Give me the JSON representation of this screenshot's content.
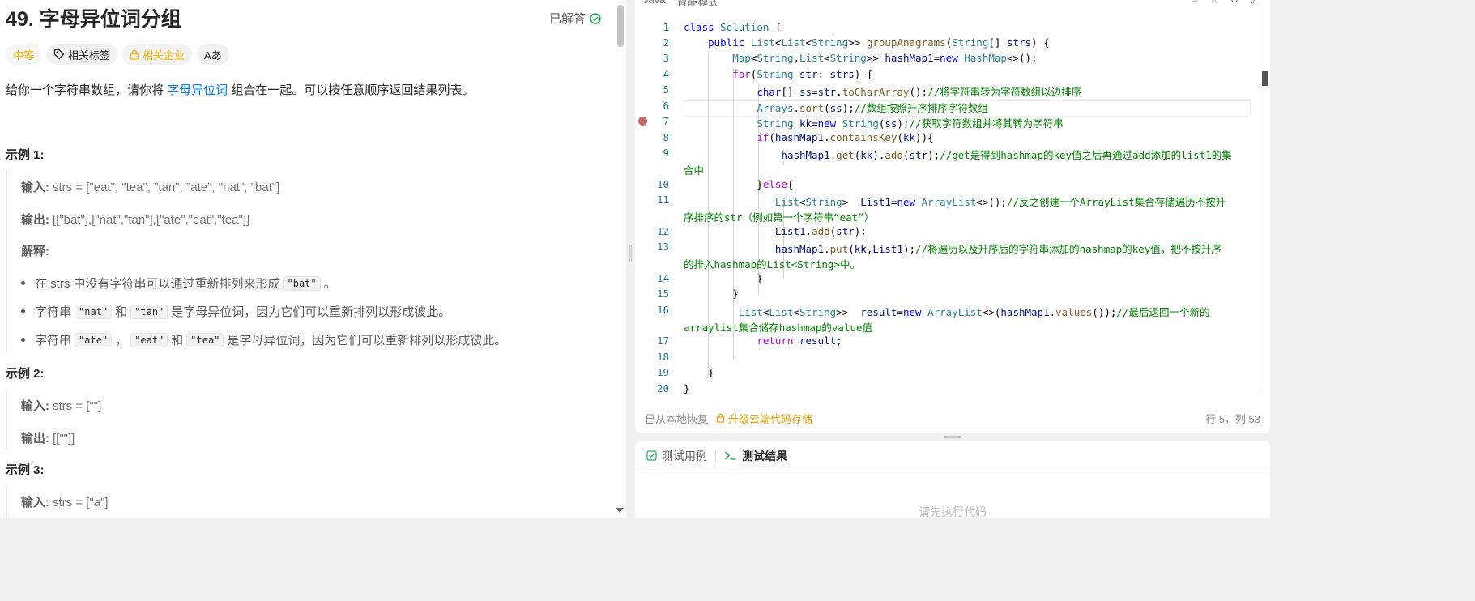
{
  "problem": {
    "title": "49. 字母异位词分组",
    "status": "已解答",
    "tags": [
      "中等",
      "相关标签",
      "相关企业",
      "Aあ"
    ],
    "desc_pre": "给你一个字符串数组，请你将 ",
    "desc_link": "字母异位词",
    "desc_post": " 组合在一起。可以按任意顺序返回结果列表。",
    "ex1_title": "示例 1:",
    "ex1_input_label": "输入:",
    "ex1_input": "strs = [\"eat\", \"tea\", \"tan\", \"ate\", \"nat\", \"bat\"]",
    "ex1_output_label": "输出:",
    "ex1_output": "[[\"bat\"],[\"nat\",\"tan\"],[\"ate\",\"eat\",\"tea\"]]",
    "ex1_expl": "解释:",
    "b1_pre": "在 strs 中没有字符串可以通过重新排列来形成 ",
    "b1_code": "\"bat\"",
    "b1_post": "。",
    "b2_pre": "字符串 ",
    "b2_code1": "\"nat\"",
    "b2_mid": " 和 ",
    "b2_code2": "\"tan\"",
    "b2_post": " 是字母异位词，因为它们可以重新排列以形成彼此。",
    "b3_pre": "字符串 ",
    "b3_code1": "\"ate\"",
    "b3_sep1": " ，",
    "b3_code2": "\"eat\"",
    "b3_sep2": " 和 ",
    "b3_code3": "\"tea\"",
    "b3_post": " 是字母异位词，因为它们可以重新排列以形成彼此。",
    "ex2_title": "示例 2:",
    "ex2_input_label": "输入:",
    "ex2_input": "strs = [\"\"]",
    "ex2_output_label": "输出:",
    "ex2_output": "[[\"\"]]",
    "ex3_title": "示例 3:",
    "ex3_input_label": "输入:",
    "ex3_input": "strs = [\"a\"]"
  },
  "editor": {
    "language": "Java",
    "mode": "智能模式",
    "restored": "已从本地恢复",
    "upgrade": "升级云端代码存储",
    "cursor": "行 5，列 53",
    "line_numbers": [
      "1",
      "2",
      "3",
      "4",
      "5",
      "6",
      "7",
      "8",
      "9",
      "10",
      "11",
      "12",
      "13",
      "14",
      "15",
      "16",
      "17",
      "18",
      "19",
      "20"
    ]
  },
  "tests": {
    "tab_cases": "测试用例",
    "tab_results": "测试结果",
    "hint": "请先执行代码"
  },
  "colors": {
    "accent": "#007aff",
    "medium": "#ffb800",
    "success": "#2db55d",
    "keyword": "#0000ff",
    "comment": "#008000"
  }
}
